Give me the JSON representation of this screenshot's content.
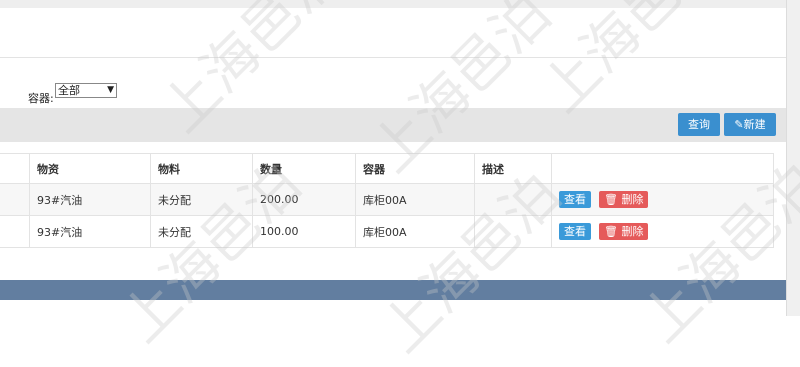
{
  "filter": {
    "container_label": "容器:",
    "container_value": "全部"
  },
  "toolbar": {
    "query_label": "查询",
    "new_label": "新建",
    "new_icon": "pencil-icon"
  },
  "table": {
    "columns": [
      "",
      "物资",
      "物料",
      "数量",
      "容器",
      "描述",
      ""
    ],
    "rows": [
      {
        "material": "93#汽油",
        "item": "未分配",
        "quantity": "200.00",
        "container": "库柜00A",
        "desc": ""
      },
      {
        "material": "93#汽油",
        "item": "未分配",
        "quantity": "100.00",
        "container": "库柜00A",
        "desc": ""
      }
    ],
    "view_label": "查看",
    "delete_label": "删除",
    "delete_icon": "trash-icon"
  },
  "watermark": "上海邑泊",
  "colors": {
    "accent": "#3a8fcf",
    "danger": "#e55a5a",
    "footer": "#627ea0"
  }
}
